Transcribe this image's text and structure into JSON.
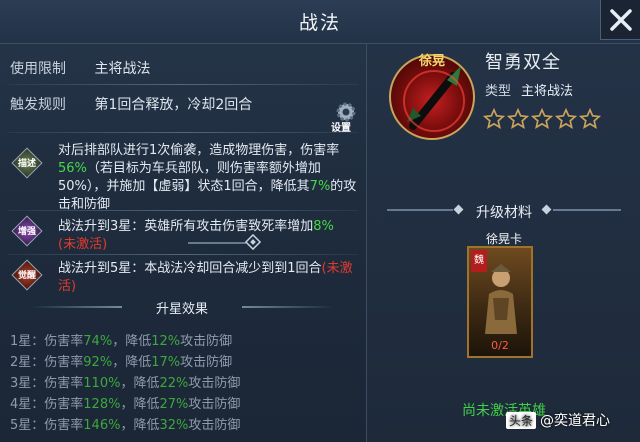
{
  "header": {
    "title": "战法",
    "close_icon": "close-icon"
  },
  "left": {
    "usage_label": "使用限制",
    "usage_value": "主将战法",
    "trigger_label": "触发规则",
    "trigger_value": "第1回合释放，冷却2回合",
    "settings_label": "设置",
    "desc_badge": "描述",
    "desc": {
      "p1": "对后排部队进行1次偷袭，造成物理伤害，伤害率",
      "v1": "56%",
      "p2": "（若目标为车兵部队，则伤害率额外增加50%），并施加【虚弱】状态1回合，降低其",
      "v2": "7%",
      "p3": "的攻击和防御"
    },
    "enhance_badge": "增强",
    "enhance": {
      "p1": "战法升到3星：英雄所有攻击伤害致死率增加",
      "v1": "8%",
      "inactive": "(未激活)"
    },
    "awaken_badge": "觉醒",
    "awaken": {
      "p1": "战法升到5星：本战法冷却回合减少到到1回合",
      "inactive": "(未激活)"
    },
    "star_title": "升星效果",
    "star_levels": [
      {
        "level": "1星：伤害率",
        "dmg": "74%",
        "mid": "，降低",
        "red": "12%",
        "tail": "攻击防御"
      },
      {
        "level": "2星：伤害率",
        "dmg": "92%",
        "mid": "，降低",
        "red": "17%",
        "tail": "攻击防御"
      },
      {
        "level": "3星：伤害率",
        "dmg": "110%",
        "mid": "，降低",
        "red": "22%",
        "tail": "攻击防御"
      },
      {
        "level": "4星：伤害率",
        "dmg": "128%",
        "mid": "，降低",
        "red": "27%",
        "tail": "攻击防御"
      },
      {
        "level": "5星：伤害率",
        "dmg": "146%",
        "mid": "，降低",
        "red": "32%",
        "tail": "攻击防御"
      }
    ]
  },
  "right": {
    "hero_name": "徐晃",
    "skill_name": "智勇双全",
    "type_label": "类型",
    "type_value": "主将战法",
    "stars_filled": 0,
    "stars_total": 5,
    "upgrade_title": "升级材料",
    "card_name": "徐晃卡",
    "card_faction": "魏",
    "card_count": "0/2",
    "inactive_hero": "尚未激活英雄"
  },
  "watermark": {
    "source": "头条",
    "author": "@奕道君心"
  },
  "colors": {
    "green": "#48d848",
    "red": "#e23a2e",
    "gold": "#f4d86a"
  }
}
